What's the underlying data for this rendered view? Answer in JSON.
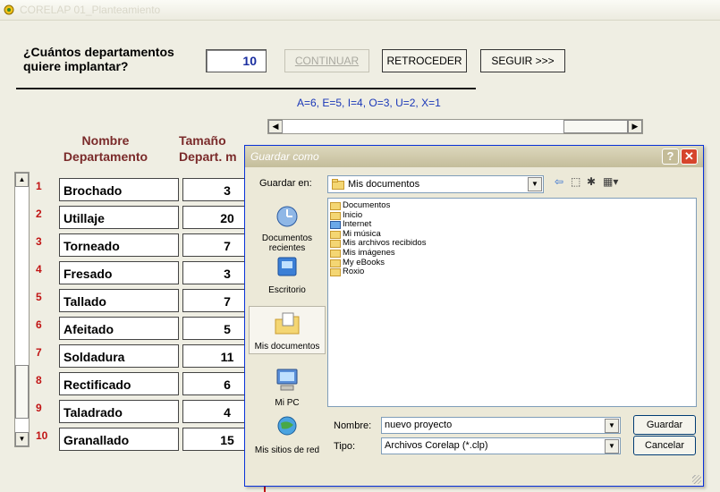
{
  "window": {
    "title": "CORELAP 01_Planteamiento"
  },
  "header": {
    "question": "¿Cuántos departamentos\nquiere implantar?",
    "count": "10",
    "buttons": {
      "continuar": "CONTINUAR",
      "retroceder": "RETROCEDER",
      "seguir": "SEGUIR >>>"
    }
  },
  "legend": "A=6, E=5, I=4, O=3, U=2, X=1",
  "table": {
    "col_name": "Nombre\nDepartamento",
    "col_size": "Tamaño\nDepart. m",
    "rows": [
      {
        "num": "1",
        "name": "Brochado",
        "size": "3"
      },
      {
        "num": "2",
        "name": "Utillaje",
        "size": "20"
      },
      {
        "num": "3",
        "name": "Torneado",
        "size": "7"
      },
      {
        "num": "4",
        "name": "Fresado",
        "size": "3"
      },
      {
        "num": "5",
        "name": "Tallado",
        "size": "7"
      },
      {
        "num": "6",
        "name": "Afeitado",
        "size": "5"
      },
      {
        "num": "7",
        "name": "Soldadura",
        "size": "11"
      },
      {
        "num": "8",
        "name": "Rectificado",
        "size": "6"
      },
      {
        "num": "9",
        "name": "Taladrado",
        "size": "4"
      },
      {
        "num": "10",
        "name": "Granallado",
        "size": "15"
      }
    ]
  },
  "dialog": {
    "title": "Guardar como",
    "save_in_label": "Guardar en:",
    "save_in_value": "Mis documentos",
    "places": [
      "Documentos recientes",
      "Escritorio",
      "Mis documentos",
      "Mi PC",
      "Mis sitios de red"
    ],
    "files": [
      "Documentos",
      "Inicio",
      "Internet",
      "Mi música",
      "Mis archivos recibidos",
      "Mis imágenes",
      "My eBooks",
      "Roxio"
    ],
    "name_label": "Nombre:",
    "name_value": "nuevo proyecto",
    "type_label": "Tipo:",
    "type_value": "Archivos Corelap (*.clp)",
    "save_button": "Guardar",
    "cancel_button": "Cancelar"
  },
  "colors": {
    "accent_red": "#c11414",
    "legend_blue": "#1a37b8",
    "header_maroon": "#7a2a2a"
  }
}
